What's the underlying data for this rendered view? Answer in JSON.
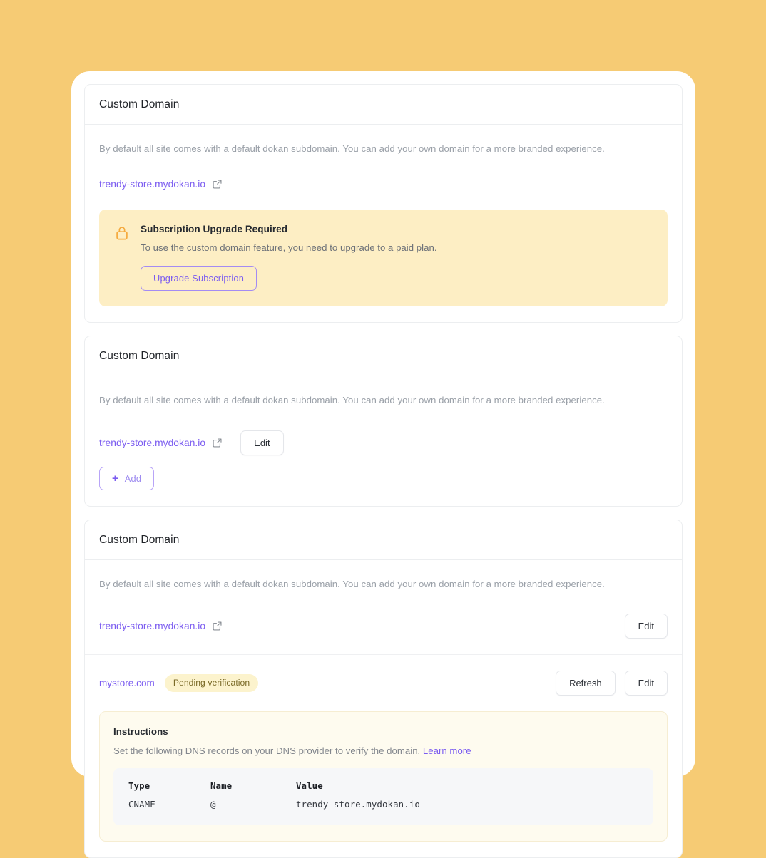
{
  "theme": {
    "page_background": "#f6cb74",
    "accent_purple": "#7b5cf0",
    "notice_background": "#fdeec4",
    "badge_background": "#fcf3cd",
    "badge_text": "#7a6a27",
    "instructions_background": "#fefbef"
  },
  "shared": {
    "card_title": "Custom Domain",
    "description": "By default all site comes with a default dokan subdomain. You can add your own domain for a more branded experience.",
    "subdomain": "trendy-store.mydokan.io",
    "external_link_icon": "external-link-icon",
    "edit_label": "Edit"
  },
  "card_locked": {
    "title": "Custom Domain",
    "description": "By default all site comes with a default dokan subdomain. You can add your own domain for a more branded experience.",
    "subdomain": "trendy-store.mydokan.io",
    "notice": {
      "icon": "lock-icon",
      "title": "Subscription Upgrade Required",
      "text": "To use the custom domain feature, you need to upgrade to a paid plan.",
      "button_label": "Upgrade Subscription"
    }
  },
  "card_add": {
    "title": "Custom Domain",
    "description": "By default all site comes with a default dokan subdomain. You can add your own domain for a more branded experience.",
    "subdomain": "trendy-store.mydokan.io",
    "edit_label": "Edit",
    "add_icon": "plus-icon",
    "add_label": "Add"
  },
  "card_pending": {
    "title": "Custom Domain",
    "description": "By default all site comes with a default dokan subdomain. You can add your own domain for a more branded experience.",
    "subdomain": "trendy-store.mydokan.io",
    "subdomain_edit_label": "Edit",
    "custom_domain": "mystore.com",
    "status_badge": "Pending verification",
    "refresh_label": "Refresh",
    "custom_edit_label": "Edit",
    "instructions": {
      "title": "Instructions",
      "text": "Set the following DNS records on your DNS provider to verify the domain.",
      "link_label": "Learn more",
      "table": {
        "headers": [
          "Type",
          "Name",
          "Value"
        ],
        "rows": [
          [
            "CNAME",
            "@",
            "trendy-store.mydokan.io"
          ]
        ]
      }
    }
  }
}
